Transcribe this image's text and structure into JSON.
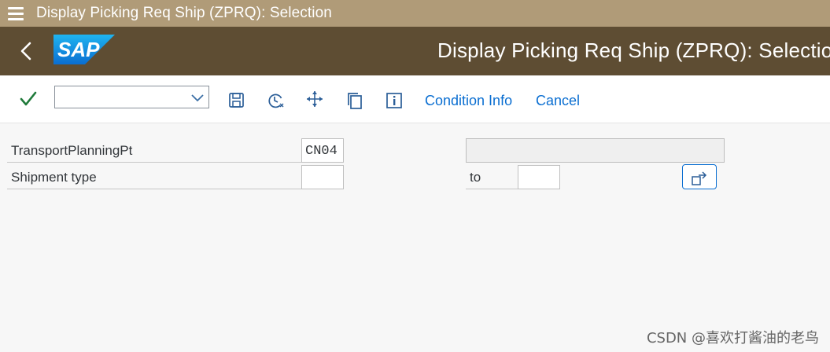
{
  "window": {
    "title": "Display Picking Req Ship (ZPRQ): Selection"
  },
  "shell": {
    "app_title": "Display Picking Req Ship (ZPRQ): Selection",
    "logo_text": "SAP",
    "brand_color": "#0a6ed1",
    "header_color": "#5e4d33"
  },
  "toolbar": {
    "command_field_value": "",
    "icons": [
      "check-icon",
      "save-icon",
      "variant-clock-icon",
      "move-icon",
      "copy-icon",
      "info-icon"
    ],
    "condition_info_label": "Condition Info",
    "cancel_label": "Cancel"
  },
  "form": {
    "transport_label": "TransportPlanningPt",
    "transport_value": "CN04",
    "transport_description": "",
    "shipment_label": "Shipment type",
    "shipment_from": "",
    "to_label": "to",
    "shipment_to": ""
  },
  "watermark": "CSDN @喜欢打酱油的老鸟"
}
